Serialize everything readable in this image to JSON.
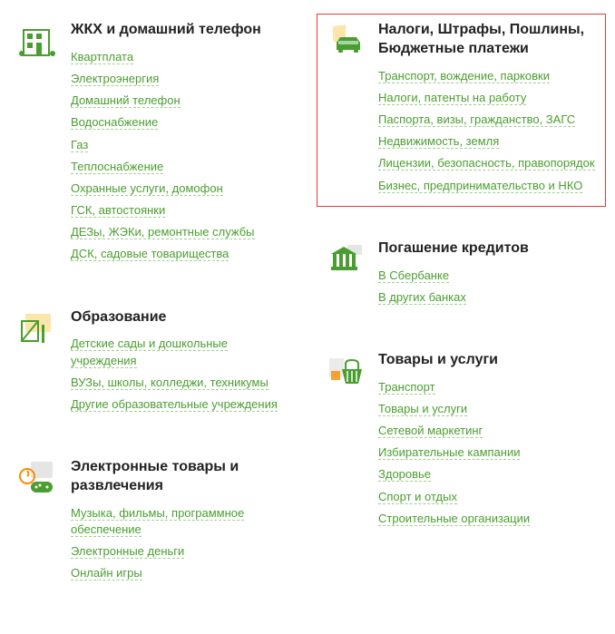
{
  "categories_left": [
    {
      "title": "ЖКХ и домашний телефон",
      "icon": "house-icon",
      "links": [
        "Квартплата",
        "Электроэнергия",
        "Домашний телефон",
        "Водоснабжение",
        "Газ",
        "Теплоснабжение",
        "Охранные услуги, домофон",
        "ГСК, автостоянки",
        "ДЕЗы, ЖЭКи, ремонтные службы",
        "ДСК, садовые товарищества"
      ]
    },
    {
      "title": "Образование",
      "icon": "education-icon",
      "links": [
        "Детские сады и дошкольные учреждения",
        "ВУЗы, школы, колледжи, техникумы",
        "Другие образовательные учреждения"
      ]
    },
    {
      "title": "Электронные товары и развлечения",
      "icon": "entertainment-icon",
      "links": [
        "Музыка, фильмы, программное обеспечение",
        "Электронные деньги",
        "Онлайн игры"
      ]
    }
  ],
  "categories_right": [
    {
      "title": "Налоги, Штрафы, Пошлины, Бюджетные платежи",
      "icon": "car-shield-icon",
      "highlighted": true,
      "links": [
        "Транспорт, вождение, парковки",
        "Налоги, патенты на работу",
        "Паспорта, визы, гражданство, ЗАГС",
        "Недвижимость, земля",
        "Лицензии, безопасность, правопорядок",
        "Бизнес, предпринимательство и НКО"
      ]
    },
    {
      "title": "Погашение кредитов",
      "icon": "bank-icon",
      "links": [
        "В Сбербанке",
        "В других банках"
      ]
    },
    {
      "title": "Товары и услуги",
      "icon": "basket-icon",
      "links": [
        "Транспорт",
        "Товары и услуги",
        "Сетевой маркетинг",
        "Избирательные кампании",
        "Здоровье",
        "Спорт и отдых",
        "Строительные организации"
      ]
    }
  ]
}
